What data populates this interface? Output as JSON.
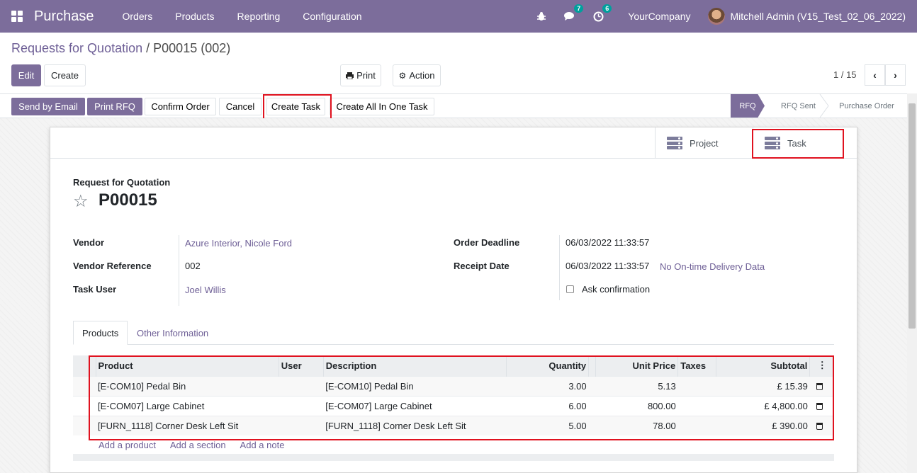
{
  "navbar": {
    "app_name": "Purchase",
    "menu": [
      "Orders",
      "Products",
      "Reporting",
      "Configuration"
    ],
    "chat_count": "7",
    "activity_count": "6",
    "company": "YourCompany",
    "user": "Mitchell Admin (V15_Test_02_06_2022)"
  },
  "breadcrumb": {
    "parent": "Requests for Quotation",
    "separator": "/",
    "current": "P00015 (002)"
  },
  "control": {
    "edit": "Edit",
    "create": "Create",
    "print": "Print",
    "action": "Action",
    "pager": "1 / 15"
  },
  "statusbar": {
    "buttons": [
      "Send by Email",
      "Print RFQ",
      "Confirm Order",
      "Cancel",
      "Create Task",
      "Create All In One Task"
    ],
    "stages": [
      "RFQ",
      "RFQ Sent",
      "Purchase Order"
    ]
  },
  "smart_buttons": {
    "project": "Project",
    "task": "Task"
  },
  "form": {
    "subtitle": "Request for Quotation",
    "name": "P00015",
    "vendor_label": "Vendor",
    "vendor": "Azure Interior, Nicole Ford",
    "vendor_ref_label": "Vendor Reference",
    "vendor_ref": "002",
    "task_user_label": "Task User",
    "task_user": "Joel Willis",
    "deadline_label": "Order Deadline",
    "deadline": "06/03/2022 11:33:57",
    "receipt_label": "Receipt Date",
    "receipt": "06/03/2022 11:33:57",
    "delivery_link": "No On-time Delivery Data",
    "ask_confirmation": "Ask confirmation"
  },
  "tabs": [
    "Products",
    "Other Information"
  ],
  "lines": {
    "headers": [
      "Product",
      "User",
      "Description",
      "Quantity",
      "Unit Price",
      "Taxes",
      "Subtotal"
    ],
    "rows": [
      {
        "product": "[E-COM10] Pedal Bin",
        "user": "",
        "description": "[E-COM10] Pedal Bin",
        "quantity": "3.00",
        "price": "5.13",
        "taxes": "",
        "subtotal": "£ 15.39"
      },
      {
        "product": "[E-COM07] Large Cabinet",
        "user": "",
        "description": "[E-COM07] Large Cabinet",
        "quantity": "6.00",
        "price": "800.00",
        "taxes": "",
        "subtotal": "£ 4,800.00"
      },
      {
        "product": "[FURN_1118] Corner Desk Left Sit",
        "user": "",
        "description": "[FURN_1118] Corner Desk Left Sit",
        "quantity": "5.00",
        "price": "78.00",
        "taxes": "",
        "subtotal": "£ 390.00"
      }
    ],
    "add_product": "Add a product",
    "add_section": "Add a section",
    "add_note": "Add a note"
  }
}
